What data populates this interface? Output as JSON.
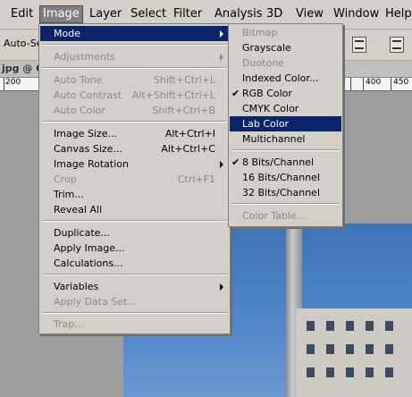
{
  "menubar": {
    "items": [
      "Edit",
      "Image",
      "Layer",
      "Select",
      "Filter",
      "Analysis",
      "3D",
      "View",
      "Window",
      "Help"
    ]
  },
  "options_bar": {
    "auto_select": "Auto-Se"
  },
  "document": {
    "tab_title": "jpg @ 6"
  },
  "ruler": {
    "labels": [
      "200",
      "400",
      "450"
    ]
  },
  "image_menu": {
    "mode": "Mode",
    "adjustments": "Adjustments",
    "auto_tone": "Auto Tone",
    "auto_tone_sc": "Shift+Ctrl+L",
    "auto_contrast": "Auto Contrast",
    "auto_contrast_sc": "Alt+Shift+Ctrl+L",
    "auto_color": "Auto Color",
    "auto_color_sc": "Shift+Ctrl+B",
    "image_size": "Image Size...",
    "image_size_sc": "Alt+Ctrl+I",
    "canvas_size": "Canvas Size...",
    "canvas_size_sc": "Alt+Ctrl+C",
    "image_rotation": "Image Rotation",
    "crop": "Crop",
    "crop_sc": "Ctrl+F1",
    "trim": "Trim...",
    "reveal_all": "Reveal All",
    "duplicate": "Duplicate...",
    "apply_image": "Apply Image...",
    "calculations": "Calculations...",
    "variables": "Variables",
    "apply_data_set": "Apply Data Set...",
    "trap": "Trap..."
  },
  "mode_menu": {
    "bitmap": "Bitmap",
    "grayscale": "Grayscale",
    "duotone": "Duotone",
    "indexed_color": "Indexed Color...",
    "rgb_color": "RGB Color",
    "cmyk_color": "CMYK Color",
    "lab_color": "Lab Color",
    "multichannel": "Multichannel",
    "bits8": "8 Bits/Channel",
    "bits16": "16 Bits/Channel",
    "bits32": "32 Bits/Channel",
    "color_table": "Color Table...",
    "check_mark": "✔"
  },
  "colors": {
    "menu_bg": "#d4d0c8",
    "highlight": "#0a246a",
    "disabled_text": "#8c8a84"
  }
}
